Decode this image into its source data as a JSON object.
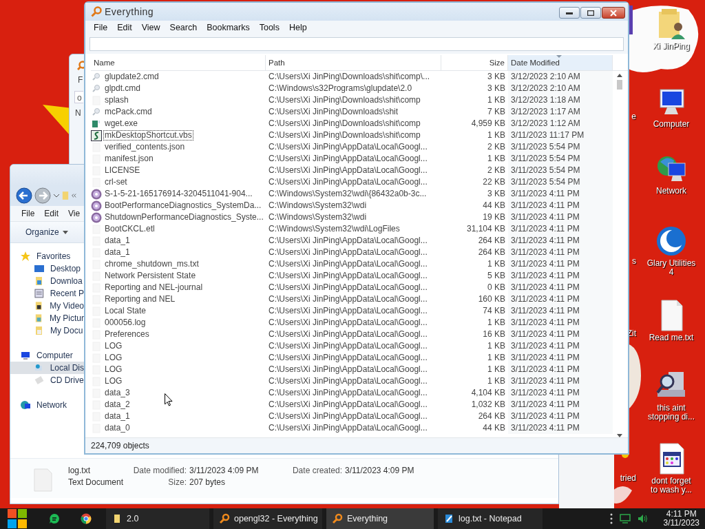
{
  "desktop": {
    "icons": [
      {
        "label": "Xi JinPing",
        "kind": "user-folder"
      },
      {
        "label": "Computer",
        "kind": "computer"
      },
      {
        "label": "Network",
        "kind": "network"
      },
      {
        "label": "Glary Utilities 4",
        "kind": "glary"
      },
      {
        "label": "Read me.txt",
        "kind": "text"
      },
      {
        "label": "this aint stopping di...",
        "kind": "search-pc"
      },
      {
        "label": "dont forget to wash y...",
        "kind": "app-doc"
      }
    ],
    "cut_labels": [
      "e",
      "s",
      "Zit",
      "tried"
    ]
  },
  "back_window": {
    "menu_fragment": "F",
    "search_fragment": "o",
    "header_fragment": "N"
  },
  "explorer": {
    "menu": [
      "File",
      "Edit",
      "Vie"
    ],
    "organize": "Organize",
    "nav": [
      {
        "label": "Favorites",
        "selected": false,
        "children": [
          {
            "label": "Desktop",
            "selected": false
          },
          {
            "label": "Downloa",
            "selected": false
          },
          {
            "label": "Recent P",
            "selected": false
          },
          {
            "label": "My Video",
            "selected": false
          },
          {
            "label": "My Pictur",
            "selected": false
          },
          {
            "label": "My Docu",
            "selected": false
          }
        ]
      },
      {
        "label": "Computer",
        "selected": false,
        "children": [
          {
            "label": "Local Dis",
            "selected": true
          },
          {
            "label": "CD Drive",
            "selected": false
          }
        ]
      },
      {
        "label": "Network",
        "selected": false
      }
    ],
    "details": {
      "name": "log.txt",
      "type": "Text Document",
      "fields": [
        {
          "label": "Date modified:",
          "value": "3/11/2023 4:09 PM"
        },
        {
          "label": "Date created:",
          "value": "3/11/2023 4:09 PM"
        },
        {
          "label": "Size:",
          "value": "207 bytes"
        }
      ]
    }
  },
  "everything": {
    "window": {
      "title": "Everything"
    },
    "menu": [
      "File",
      "Edit",
      "View",
      "Search",
      "Bookmarks",
      "Tools",
      "Help"
    ],
    "columns": [
      {
        "label": "Name",
        "sorted": false
      },
      {
        "label": "Path",
        "sorted": false
      },
      {
        "label": "Size",
        "sorted": false
      },
      {
        "label": "Date Modified",
        "sorted": true
      }
    ],
    "rows": [
      {
        "name": "glupdate2.cmd",
        "path": "C:\\Users\\Xi JinPing\\Downloads\\shit\\comp\\...",
        "size": "3 KB",
        "modified": "3/12/2023 2:10 AM",
        "selected": false
      },
      {
        "name": "glpdt.cmd",
        "path": "C:\\Windows\\s32Programs\\glupdate\\2.0",
        "size": "3 KB",
        "modified": "3/12/2023 2:10 AM",
        "selected": false
      },
      {
        "name": "splash",
        "path": "C:\\Users\\Xi JinPing\\Downloads\\shit\\comp",
        "size": "1 KB",
        "modified": "3/12/2023 1:18 AM",
        "selected": false
      },
      {
        "name": "mcPack.cmd",
        "path": "C:\\Users\\Xi JinPing\\Downloads\\shit",
        "size": "7 KB",
        "modified": "3/12/2023 1:17 AM",
        "selected": false
      },
      {
        "name": "wget.exe",
        "path": "C:\\Users\\Xi JinPing\\Downloads\\shit\\comp",
        "size": "4,959 KB",
        "modified": "3/12/2023 1:12 AM",
        "selected": false
      },
      {
        "name": "mkDesktopShortcut.vbs",
        "path": "C:\\Users\\Xi JinPing\\Downloads\\shit\\comp",
        "size": "1 KB",
        "modified": "3/11/2023 11:17 PM",
        "selected": true
      },
      {
        "name": "verified_contents.json",
        "path": "C:\\Users\\Xi JinPing\\AppData\\Local\\Googl...",
        "size": "2 KB",
        "modified": "3/11/2023 5:54 PM",
        "selected": false
      },
      {
        "name": "manifest.json",
        "path": "C:\\Users\\Xi JinPing\\AppData\\Local\\Googl...",
        "size": "1 KB",
        "modified": "3/11/2023 5:54 PM",
        "selected": false
      },
      {
        "name": "LICENSE",
        "path": "C:\\Users\\Xi JinPing\\AppData\\Local\\Googl...",
        "size": "2 KB",
        "modified": "3/11/2023 5:54 PM",
        "selected": false
      },
      {
        "name": "crl-set",
        "path": "C:\\Users\\Xi JinPing\\AppData\\Local\\Googl...",
        "size": "22 KB",
        "modified": "3/11/2023 5:54 PM",
        "selected": false
      },
      {
        "name": "S-1-5-21-165176914-3204511041-904...",
        "path": "C:\\Windows\\System32\\wdi\\{86432a0b-3c...",
        "size": "3 KB",
        "modified": "3/11/2023 4:11 PM",
        "selected": false
      },
      {
        "name": "BootPerformanceDiagnostics_SystemDa...",
        "path": "C:\\Windows\\System32\\wdi",
        "size": "44 KB",
        "modified": "3/11/2023 4:11 PM",
        "selected": false
      },
      {
        "name": "ShutdownPerformanceDiagnostics_Syste...",
        "path": "C:\\Windows\\System32\\wdi",
        "size": "19 KB",
        "modified": "3/11/2023 4:11 PM",
        "selected": false
      },
      {
        "name": "BootCKCL.etl",
        "path": "C:\\Windows\\System32\\wdi\\LogFiles",
        "size": "31,104 KB",
        "modified": "3/11/2023 4:11 PM",
        "selected": false
      },
      {
        "name": "data_1",
        "path": "C:\\Users\\Xi JinPing\\AppData\\Local\\Googl...",
        "size": "264 KB",
        "modified": "3/11/2023 4:11 PM",
        "selected": false
      },
      {
        "name": "data_1",
        "path": "C:\\Users\\Xi JinPing\\AppData\\Local\\Googl...",
        "size": "264 KB",
        "modified": "3/11/2023 4:11 PM",
        "selected": false
      },
      {
        "name": "chrome_shutdown_ms.txt",
        "path": "C:\\Users\\Xi JinPing\\AppData\\Local\\Googl...",
        "size": "1 KB",
        "modified": "3/11/2023 4:11 PM",
        "selected": false
      },
      {
        "name": "Network Persistent State",
        "path": "C:\\Users\\Xi JinPing\\AppData\\Local\\Googl...",
        "size": "5 KB",
        "modified": "3/11/2023 4:11 PM",
        "selected": false
      },
      {
        "name": "Reporting and NEL-journal",
        "path": "C:\\Users\\Xi JinPing\\AppData\\Local\\Googl...",
        "size": "0 KB",
        "modified": "3/11/2023 4:11 PM",
        "selected": false
      },
      {
        "name": "Reporting and NEL",
        "path": "C:\\Users\\Xi JinPing\\AppData\\Local\\Googl...",
        "size": "160 KB",
        "modified": "3/11/2023 4:11 PM",
        "selected": false
      },
      {
        "name": "Local State",
        "path": "C:\\Users\\Xi JinPing\\AppData\\Local\\Googl...",
        "size": "74 KB",
        "modified": "3/11/2023 4:11 PM",
        "selected": false
      },
      {
        "name": "000056.log",
        "path": "C:\\Users\\Xi JinPing\\AppData\\Local\\Googl...",
        "size": "1 KB",
        "modified": "3/11/2023 4:11 PM",
        "selected": false
      },
      {
        "name": "Preferences",
        "path": "C:\\Users\\Xi JinPing\\AppData\\Local\\Googl...",
        "size": "16 KB",
        "modified": "3/11/2023 4:11 PM",
        "selected": false
      },
      {
        "name": "LOG",
        "path": "C:\\Users\\Xi JinPing\\AppData\\Local\\Googl...",
        "size": "1 KB",
        "modified": "3/11/2023 4:11 PM",
        "selected": false
      },
      {
        "name": "LOG",
        "path": "C:\\Users\\Xi JinPing\\AppData\\Local\\Googl...",
        "size": "1 KB",
        "modified": "3/11/2023 4:11 PM",
        "selected": false
      },
      {
        "name": "LOG",
        "path": "C:\\Users\\Xi JinPing\\AppData\\Local\\Googl...",
        "size": "1 KB",
        "modified": "3/11/2023 4:11 PM",
        "selected": false
      },
      {
        "name": "LOG",
        "path": "C:\\Users\\Xi JinPing\\AppData\\Local\\Googl...",
        "size": "1 KB",
        "modified": "3/11/2023 4:11 PM",
        "selected": false
      },
      {
        "name": "data_3",
        "path": "C:\\Users\\Xi JinPing\\AppData\\Local\\Googl...",
        "size": "4,104 KB",
        "modified": "3/11/2023 4:11 PM",
        "selected": false
      },
      {
        "name": "data_2",
        "path": "C:\\Users\\Xi JinPing\\AppData\\Local\\Googl...",
        "size": "1,032 KB",
        "modified": "3/11/2023 4:11 PM",
        "selected": false
      },
      {
        "name": "data_1",
        "path": "C:\\Users\\Xi JinPing\\AppData\\Local\\Googl...",
        "size": "264 KB",
        "modified": "3/11/2023 4:11 PM",
        "selected": false
      },
      {
        "name": "data_0",
        "path": "C:\\Users\\Xi JinPing\\AppData\\Local\\Googl...",
        "size": "44 KB",
        "modified": "3/11/2023 4:11 PM",
        "selected": false
      }
    ],
    "status_bar": "224,709 objects"
  },
  "taskbar": {
    "tasks": [
      {
        "label": "2.0",
        "selected": false
      },
      {
        "label": "opengl32 - Everything",
        "selected": false
      },
      {
        "label": "Everything",
        "selected": true
      },
      {
        "label": "log.txt - Notepad",
        "selected": false
      }
    ],
    "clock": {
      "time": "4:11 PM",
      "date": "3/11/2023"
    }
  }
}
